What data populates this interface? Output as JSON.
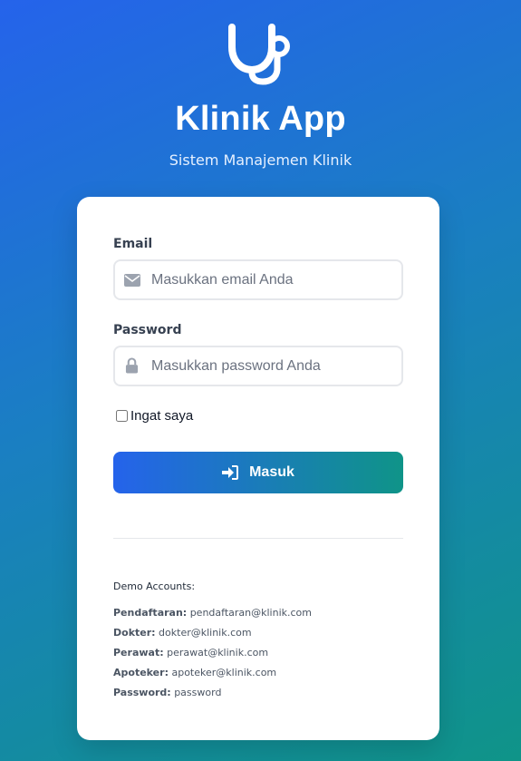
{
  "header": {
    "logo_icon": "stethoscope-icon",
    "title": "Klinik App",
    "subtitle": "Sistem Manajemen Klinik"
  },
  "form": {
    "email": {
      "label": "Email",
      "icon": "envelope-icon",
      "placeholder": "Masukkan email Anda",
      "value": ""
    },
    "password": {
      "label": "Password",
      "icon": "lock-icon",
      "placeholder": "Masukkan password Anda",
      "value": ""
    },
    "remember": {
      "label": "Ingat saya",
      "checked": false
    },
    "submit": {
      "icon": "sign-in-icon",
      "label": "Masuk"
    }
  },
  "demo": {
    "title": "Demo Accounts:",
    "accounts": [
      {
        "role": "Pendaftaran:",
        "value": "pendaftaran@klinik.com"
      },
      {
        "role": "Dokter:",
        "value": "dokter@klinik.com"
      },
      {
        "role": "Perawat:",
        "value": "perawat@klinik.com"
      },
      {
        "role": "Apoteker:",
        "value": "apoteker@klinik.com"
      },
      {
        "role": "Password:",
        "value": "password"
      }
    ]
  },
  "colors": {
    "gradient_start": "#2563eb",
    "gradient_end": "#0f9488",
    "card_bg": "#ffffff"
  }
}
